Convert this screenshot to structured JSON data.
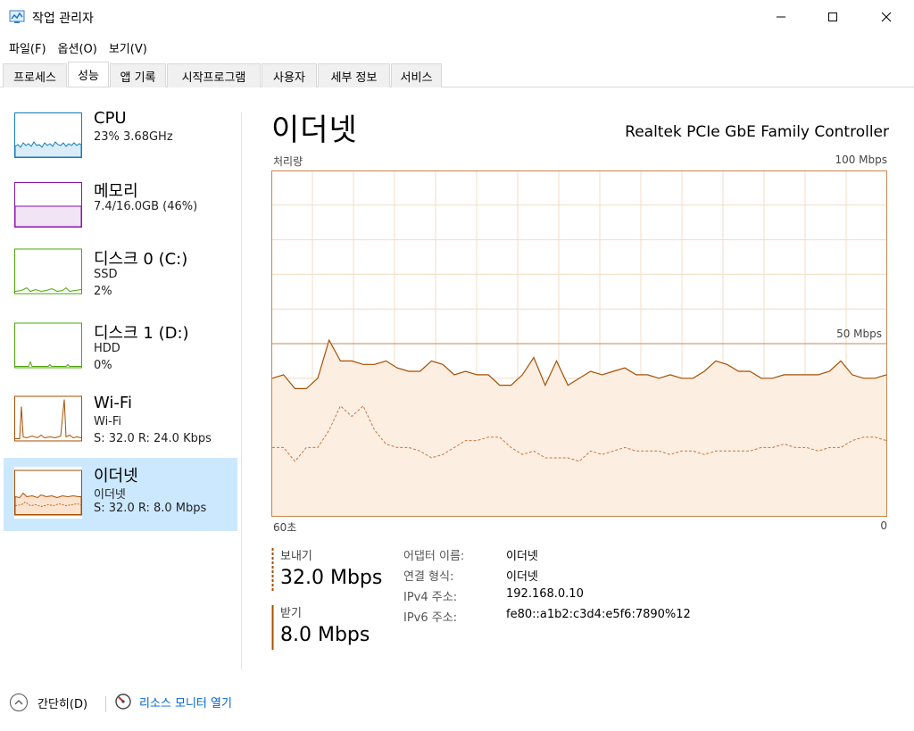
{
  "window": {
    "title": "작업 관리자"
  },
  "menu": [
    "파일(F)",
    "옵션(O)",
    "보기(V)"
  ],
  "tabs": [
    {
      "label": "프로세스",
      "active": false
    },
    {
      "label": "성능",
      "active": true
    },
    {
      "label": "앱 기록",
      "active": false
    },
    {
      "label": "시작프로그램",
      "active": false
    },
    {
      "label": "사용자",
      "active": false
    },
    {
      "label": "세부 정보",
      "active": false
    },
    {
      "label": "서비스",
      "active": false
    }
  ],
  "resources": [
    {
      "name": "CPU",
      "line1": "23% 3.68GHz",
      "line2": "",
      "color": "#117dbb",
      "selected": false
    },
    {
      "name": "메모리",
      "line1": "7.4/16.0GB (46%)",
      "line2": "",
      "color": "#8b12ae",
      "selected": false
    },
    {
      "name": "디스크 0 (C:)",
      "line1": "SSD",
      "line2": "2%",
      "color": "#4da60c",
      "selected": false
    },
    {
      "name": "디스크 1 (D:)",
      "line1": "HDD",
      "line2": "0%",
      "color": "#4da60c",
      "selected": false
    },
    {
      "name": "Wi-Fi",
      "line1": "Wi-Fi",
      "line2": "S: 32.0  R: 24.0 Kbps",
      "color": "#a74f01",
      "selected": false
    },
    {
      "name": "이더넷",
      "line1": "이더넷",
      "line2": "S: 32.0  R: 8.0 Mbps",
      "color": "#a74f01",
      "selected": true
    }
  ],
  "main": {
    "title": "이더넷",
    "adapter": "Realtek PCIe GbE Family Controller",
    "graph_label": "처리량",
    "graph_max": "100 Mbps",
    "graph_mid": "50 Mbps",
    "axis_left": "60초",
    "axis_right": "0"
  },
  "stats": {
    "send_label": "보내기",
    "send_value": "32.0 Mbps",
    "recv_label": "받기",
    "recv_value": "8.0 Mbps"
  },
  "info": [
    {
      "key": "어댑터 이름:",
      "value": "이더넷"
    },
    {
      "key": "연결 형식:",
      "value": "이더넷"
    },
    {
      "key": "IPv4 주소:",
      "value": "192.168.0.10"
    },
    {
      "key": "IPv6 주소:",
      "value": "fe80::a1b2:c3d4:e5f6:7890%12"
    }
  ],
  "footer": {
    "fewer_details": "간단히(D)",
    "resource_monitor": "리소스 모니터 열기"
  },
  "colors": {
    "accent": "#a74f01",
    "graph_border": "#c9854e",
    "graph_grid": "#f3dcc6",
    "graph_fill": "#fdeee2",
    "selected_bg": "#cce8ff"
  },
  "chart_data": {
    "type": "line",
    "x_range": [
      60,
      0
    ],
    "ylim": [
      0,
      100
    ],
    "series": [
      {
        "name": "보내기",
        "style": "solid",
        "values": [
          40,
          41,
          37,
          37,
          40,
          51,
          45,
          45,
          44,
          44,
          45,
          43,
          42,
          42,
          45,
          44,
          41,
          42,
          41,
          41,
          38,
          38,
          41,
          46,
          38,
          45,
          38,
          40,
          42,
          41,
          42,
          43,
          41,
          41,
          40,
          41,
          40,
          40,
          42,
          45,
          44,
          42,
          42,
          40,
          40,
          41,
          41,
          41,
          41,
          42,
          45,
          41,
          40,
          40,
          41
        ]
      },
      {
        "name": "받기",
        "style": "dashed",
        "values": [
          20,
          20,
          16,
          20,
          20,
          25,
          32,
          29,
          32,
          25,
          21,
          20,
          20,
          19,
          17,
          18,
          20,
          22,
          22,
          23,
          23,
          20,
          18,
          19,
          17,
          17,
          17,
          16,
          19,
          18,
          19,
          20,
          19,
          19,
          19,
          18,
          19,
          19,
          18,
          19,
          19,
          19,
          19,
          20,
          20,
          21,
          20,
          20,
          19,
          20,
          20,
          22,
          23,
          23,
          22
        ]
      }
    ]
  }
}
